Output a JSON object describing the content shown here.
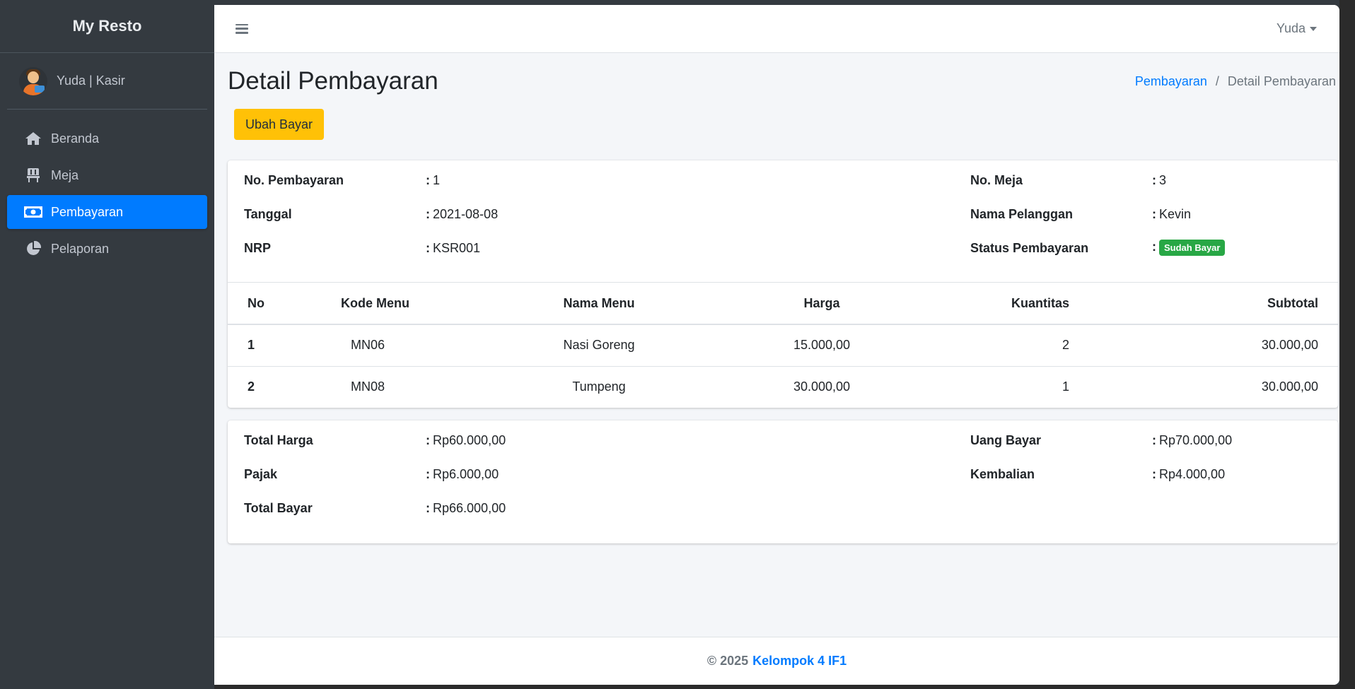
{
  "sidebar": {
    "brand": "My Resto",
    "user": "Yuda | Kasir",
    "items": [
      {
        "label": "Beranda",
        "icon": "home-icon"
      },
      {
        "label": "Meja",
        "icon": "chair-icon"
      },
      {
        "label": "Pembayaran",
        "icon": "money-bill-icon",
        "active": true
      },
      {
        "label": "Pelaporan",
        "icon": "pie-chart-icon"
      }
    ]
  },
  "topbar": {
    "user_menu": "Yuda"
  },
  "header": {
    "title": "Detail Pembayaran",
    "breadcrumb_link": "Pembayaran",
    "breadcrumb_separator": "/",
    "breadcrumb_current": "Detail Pembayaran"
  },
  "actions": {
    "edit_label": "Ubah Bayar"
  },
  "info": {
    "no_pembayaran": {
      "label": "No. Pembayaran",
      "value": "1"
    },
    "tanggal": {
      "label": "Tanggal",
      "value": "2021-08-08"
    },
    "nrp": {
      "label": "NRP",
      "value": "KSR001"
    },
    "no_meja": {
      "label": "No. Meja",
      "value": "3"
    },
    "nama_pelanggan": {
      "label": "Nama Pelanggan",
      "value": "Kevin"
    },
    "status": {
      "label": "Status Pembayaran",
      "value": "Sudah Bayar"
    },
    "colon": ":"
  },
  "table": {
    "headers": [
      "No",
      "Kode Menu",
      "Nama Menu",
      "Harga",
      "Kuantitas",
      "Subtotal"
    ],
    "rows": [
      {
        "no": "1",
        "kode": "MN06",
        "nama": "Nasi Goreng",
        "harga": "15.000,00",
        "qty": "2",
        "subtotal": "30.000,00"
      },
      {
        "no": "2",
        "kode": "MN08",
        "nama": "Tumpeng",
        "harga": "30.000,00",
        "qty": "1",
        "subtotal": "30.000,00"
      }
    ]
  },
  "summary": {
    "total_harga": {
      "label": "Total Harga",
      "value": "Rp60.000,00"
    },
    "pajak": {
      "label": "Pajak",
      "value": "Rp6.000,00"
    },
    "total_bayar": {
      "label": "Total Bayar",
      "value": "Rp66.000,00"
    },
    "uang_bayar": {
      "label": "Uang Bayar",
      "value": "Rp70.000,00"
    },
    "kembalian": {
      "label": "Kembalian",
      "value": "Rp4.000,00"
    }
  },
  "footer": {
    "copyright": "© 2025",
    "team": "Kelompok 4 IF1"
  },
  "colors": {
    "sidebar_bg": "#343a40",
    "accent": "#007bff",
    "warning": "#ffc107",
    "success": "#28a745"
  }
}
